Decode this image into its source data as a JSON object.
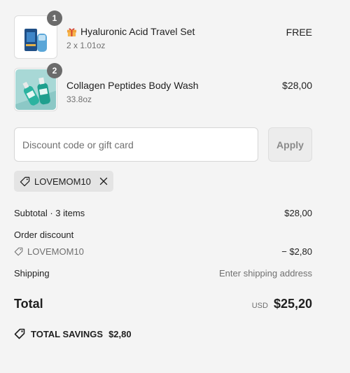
{
  "items": [
    {
      "quantity": "1",
      "title": "Hyaluronic Acid Travel Set",
      "variant": "2 x 1.01oz",
      "price": "FREE",
      "title_icon": "gift-icon"
    },
    {
      "quantity": "2",
      "title": "Collagen Peptides Body Wash",
      "variant": "33.8oz",
      "price": "$28,00"
    }
  ],
  "discount": {
    "placeholder": "Discount code or gift card",
    "apply_label": "Apply",
    "applied_code": "LOVEMOM10"
  },
  "summary": {
    "subtotal_label": "Subtotal · 3 items",
    "subtotal_value": "$28,00",
    "order_discount_label": "Order discount",
    "order_discount_code": "LOVEMOM10",
    "order_discount_value": "− $2,80",
    "shipping_label": "Shipping",
    "shipping_value": "Enter shipping address",
    "total_label": "Total",
    "currency": "USD",
    "total_value": "$25,20",
    "savings_label": "TOTAL SAVINGS",
    "savings_value": "$2,80"
  },
  "colors": {
    "background": "#f4f4f4",
    "badge": "#6b6b6b",
    "chip": "#e4e4e4"
  }
}
